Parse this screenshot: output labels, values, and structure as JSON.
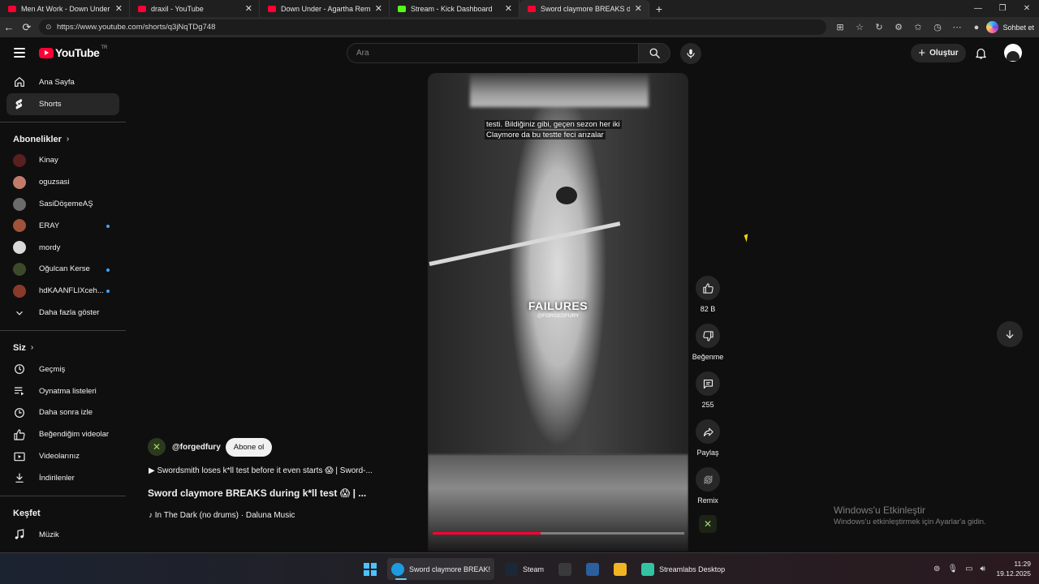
{
  "browser": {
    "tabs": [
      {
        "label": "Men At Work - Down Under (Offic",
        "favicon": "youtube"
      },
      {
        "label": "draxil - YouTube",
        "favicon": "youtube"
      },
      {
        "label": "Down Under - Agartha Remix - Yo",
        "favicon": "youtube"
      },
      {
        "label": "Stream - Kick Dashboard",
        "favicon": "kick"
      },
      {
        "label": "Sword claymore BREAKS durin",
        "favicon": "youtube",
        "active": true
      }
    ],
    "url": "https://www.youtube.com/shorts/q3jNqTDg748",
    "copilot_label": "Sohbet et"
  },
  "header": {
    "logo_text": "YouTube",
    "country_code": "TR",
    "search_placeholder": "Ara",
    "create_label": "Oluştur"
  },
  "sidebar": {
    "main": [
      {
        "label": "Ana Sayfa",
        "icon": "home-icon"
      },
      {
        "label": "Shorts",
        "icon": "shorts-icon",
        "active": true
      }
    ],
    "subscriptions_title": "Abonelikler",
    "subscriptions": [
      {
        "label": "Kinay",
        "color": "#5a1f1f",
        "new": false
      },
      {
        "label": "oguzsasi",
        "color": "#c27b6a",
        "new": false
      },
      {
        "label": "SasiDöşemeAŞ",
        "color": "#6b6b6b",
        "new": false
      },
      {
        "label": "ERAY",
        "color": "#a0523a",
        "new": true
      },
      {
        "label": "mordy",
        "color": "#d9d9d9",
        "new": false
      },
      {
        "label": "Oğulcan Kerse",
        "color": "#3d4a2a",
        "new": true
      },
      {
        "label": "hdKAANFLIXceh...",
        "color": "#8a3a2a",
        "new": true
      }
    ],
    "show_more_label": "Daha fazla göster",
    "you_title": "Siz",
    "you_items": [
      {
        "label": "Geçmiş",
        "icon": "history-icon"
      },
      {
        "label": "Oynatma listeleri",
        "icon": "playlists-icon"
      },
      {
        "label": "Daha sonra izle",
        "icon": "watch-later-icon"
      },
      {
        "label": "Beğendiğim videolar",
        "icon": "liked-videos-icon"
      },
      {
        "label": "Videolarınız",
        "icon": "your-videos-icon"
      },
      {
        "label": "İndirilenler",
        "icon": "downloads-icon"
      }
    ],
    "explore_title": "Keşfet",
    "explore_items": [
      {
        "label": "Müzik",
        "icon": "music-icon"
      }
    ]
  },
  "video": {
    "caption_line1": "testi.  Bildiğiniz gibi, geçen sezon her iki",
    "caption_line2": "Claymore da bu testte feci arızalar",
    "overlay_title": "FAILURES",
    "overlay_handle": "@FORGEDFURY",
    "progress": 0.43,
    "channel": "@forgedfury",
    "subscribe_label": "Abone ol",
    "description": "▶ Swordsmith loses k*ll test before it even starts 😱 | Sword-...",
    "title": "Sword claymore BREAKS during k*ll test 😱 | ...",
    "music": "♪ In The Dark (no drums) · Daluna Music"
  },
  "actions": {
    "like_count": "82 B",
    "dislike_label": "Beğenme",
    "comment_count": "255",
    "share_label": "Paylaş",
    "remix_label": "Remix"
  },
  "watermark": {
    "line1": "Windows'u Etkinleştir",
    "line2": "Windows'u etkinleştirmek için Ayarlar'a gidin."
  },
  "taskbar": {
    "apps": [
      {
        "label": "Sword claymore BREAK!",
        "icon": "edge-icon",
        "color": "#1e9be0",
        "active": true
      },
      {
        "label": "Steam",
        "icon": "steam-icon",
        "color": "#1b2838",
        "active": false
      },
      {
        "label": "",
        "icon": "terminal-icon",
        "color": "#3a3a3a",
        "active": false
      },
      {
        "label": "",
        "icon": "app-icon",
        "color": "#2b5f9e",
        "active": false
      },
      {
        "label": "",
        "icon": "folder-icon",
        "color": "#f0b323",
        "active": false
      },
      {
        "label": "Streamlabs Desktop",
        "icon": "streamlabs-icon",
        "color": "#31c3a2",
        "active": false
      }
    ],
    "time": "11:29",
    "date": "19.12.2025"
  }
}
